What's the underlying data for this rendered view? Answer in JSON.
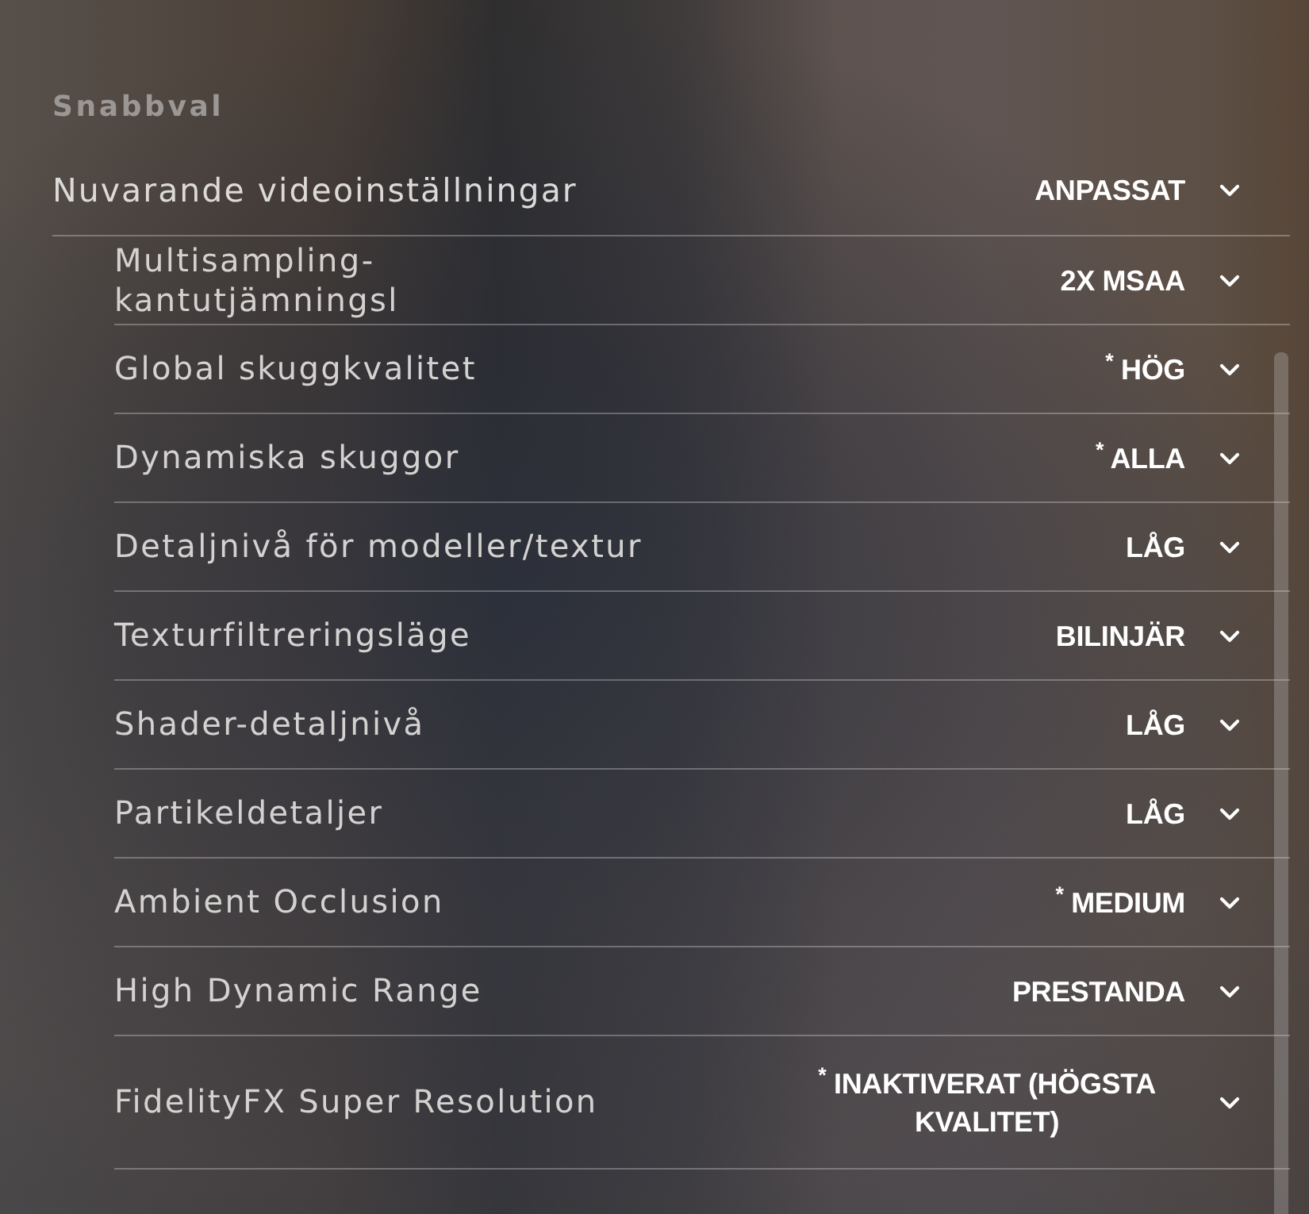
{
  "section_title": "Snabbval",
  "preset": {
    "label": "Nuvarande videoinställningar",
    "value": "ANPASSAT"
  },
  "settings": [
    {
      "label": "Multisampling-\nkantutjämningsl",
      "value": "2X MSAA"
    },
    {
      "label": "Global skuggkvalitet",
      "value": "$^{*}$ HÖG"
    },
    {
      "label": "Dynamiska skuggor",
      "value": "$^{*}$ ALLA"
    },
    {
      "label": "Detaljnivå för modeller/textur",
      "value": "LÅG"
    },
    {
      "label": "Texturfiltreringsläge",
      "value": "BILINJÄR"
    },
    {
      "label": "Shader-detaljnivå",
      "value": "LÅG"
    },
    {
      "label": "Partikeldetaljer",
      "value": "LÅG"
    },
    {
      "label": "Ambient Occlusion",
      "value": "$^{*}$ MEDIUM"
    },
    {
      "label": "High Dynamic Range",
      "value": "PRESTANDA"
    },
    {
      "label": "FidelityFX Super Resolution",
      "value": "$^{*}$ INAKTIVERAT (HÖGSTA KVALITET)"
    }
  ]
}
